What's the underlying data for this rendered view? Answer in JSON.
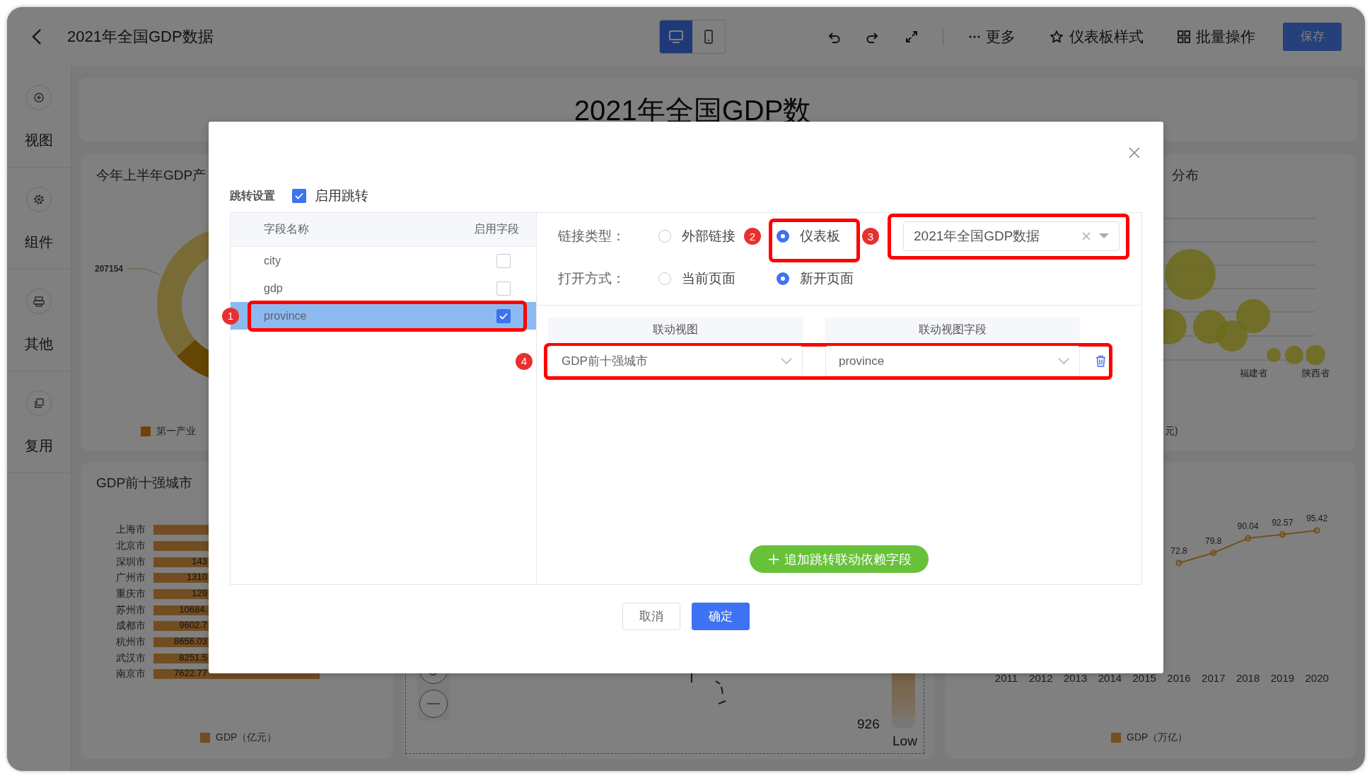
{
  "header": {
    "title": "2021年全国GDP数据",
    "view_modes": [
      {
        "kind": "desktop",
        "selected": true
      },
      {
        "kind": "mobile",
        "selected": false
      }
    ],
    "tools": [
      {
        "kind": "undo"
      },
      {
        "kind": "redo"
      },
      {
        "kind": "fullscreen"
      }
    ],
    "actions": [
      {
        "kind": "more",
        "label": "更多"
      },
      {
        "kind": "style",
        "label": "仪表板样式"
      },
      {
        "kind": "batch",
        "label": "批量操作"
      }
    ],
    "save_button": "保存"
  },
  "sidebar": {
    "items": [
      {
        "kind": "add",
        "label": "视图"
      },
      {
        "kind": "gear",
        "label": "组件"
      },
      {
        "kind": "printer",
        "label": "其他"
      },
      {
        "kind": "copy",
        "label": "复用"
      }
    ]
  },
  "board": {
    "title": "2021年全国GDP数",
    "donut_card": {
      "title": "今年上半年GDP产",
      "callout": "207154",
      "legend": "第一产业"
    },
    "bubble_card": {
      "title": "分布",
      "labels": [
        "福建省",
        "陕西省"
      ],
      "legend": "元)"
    },
    "bar_card": {
      "title": "GDP前十强城市",
      "legend": "GDP（亿元）",
      "rows": [
        {
          "label": "上海市"
        },
        {
          "label": "北京市"
        },
        {
          "label": "深圳市",
          "value": "143"
        },
        {
          "label": "广州市",
          "value": "1310"
        },
        {
          "label": "重庆市",
          "value": "129"
        },
        {
          "label": "苏州市",
          "value": "10684."
        },
        {
          "label": "成都市",
          "value": "9602.7"
        },
        {
          "label": "杭州市",
          "value": "8656.03"
        },
        {
          "label": "武汉市",
          "value": "8251.5"
        },
        {
          "label": "南京市",
          "value": "7622.77"
        }
      ]
    },
    "map_card": {
      "legend_value": "926",
      "legend_low": "Low"
    },
    "line_card": {
      "chart_data": {
        "type": "line",
        "categories": [
          "2011",
          "2012",
          "2013",
          "2014",
          "2015",
          "2016",
          "2017",
          "2018",
          "2019",
          "2020"
        ],
        "data_labels": true,
        "series": [
          {
            "name": "GDP（万亿）",
            "color": "#74501d",
            "marker": "circle",
            "values": [
              null,
              null,
              null,
              null,
              null,
              72.8,
              79.8,
              90.04,
              92.57,
              95.42
            ]
          }
        ]
      }
    }
  },
  "dialog": {
    "section_title": "跳转设置",
    "enable": {
      "label": "启用跳转",
      "checked": true
    },
    "fields": {
      "columns": [
        "字段名称",
        "启用字段"
      ],
      "rows": [
        {
          "name": "city",
          "checked": false,
          "selected": false
        },
        {
          "name": "gdp",
          "checked": false,
          "selected": false
        },
        {
          "name": "province",
          "checked": true,
          "selected": true,
          "annotation": "1"
        }
      ]
    },
    "link_type": {
      "label": "链接类型：",
      "options": [
        {
          "label": "外部链接",
          "selected": false
        },
        {
          "label": "仪表板",
          "selected": true,
          "annotation": "2"
        }
      ],
      "target": {
        "value": "2021年全国GDP数据",
        "annotation": "3"
      }
    },
    "open_mode": {
      "label": "打开方式：",
      "options": [
        {
          "label": "当前页面",
          "selected": false
        },
        {
          "label": "新开页面",
          "selected": true
        }
      ]
    },
    "mapping": {
      "columns": [
        "联动视图",
        "联动视图字段"
      ],
      "rows": [
        {
          "view": "GDP前十强城市",
          "field": "province",
          "annotation": "4"
        }
      ]
    },
    "add_button": "追加跳转联动依赖字段",
    "buttons": [
      {
        "kind": "default",
        "label": "取消"
      },
      {
        "kind": "primary",
        "label": "确定"
      }
    ]
  }
}
